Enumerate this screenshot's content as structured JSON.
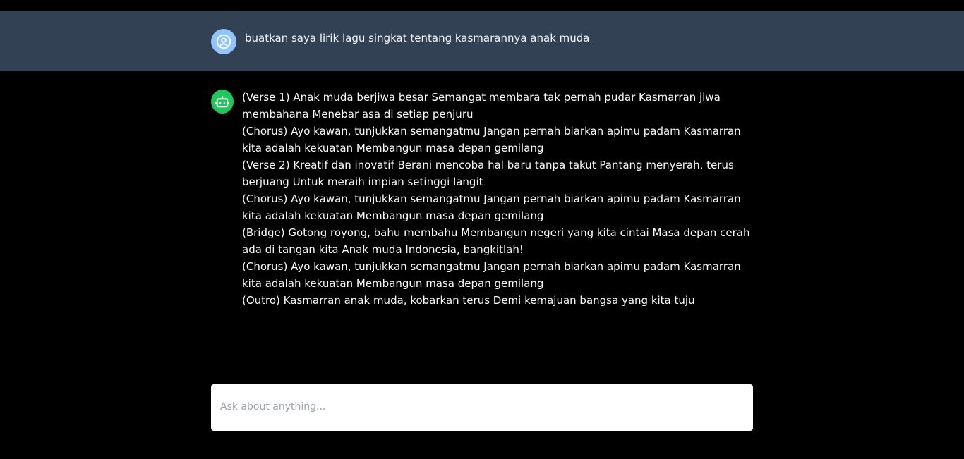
{
  "user_message": {
    "avatar_icon": "user-circle-icon",
    "text": "buatkan saya lirik lagu singkat tentang kasmarannya anak muda"
  },
  "assistant_message": {
    "avatar_icon": "robot-icon",
    "lines": [
      "(Verse 1) Anak muda berjiwa besar Semangat membara tak pernah pudar Kasmarran jiwa membahana Menebar asa di setiap penjuru",
      "(Chorus) Ayo kawan, tunjukkan semangatmu Jangan pernah biarkan apimu padam Kasmarran kita adalah kekuatan Membangun masa depan gemilang",
      "(Verse 2) Kreatif dan inovatif Berani mencoba hal baru tanpa takut Pantang menyerah, terus berjuang Untuk meraih impian setinggi langit",
      "(Chorus) Ayo kawan, tunjukkan semangatmu Jangan pernah biarkan apimu padam Kasmarran kita adalah kekuatan Membangun masa depan gemilang",
      "(Bridge) Gotong royong, bahu membahu Membangun negeri yang kita cintai Masa depan cerah ada di tangan kita Anak muda Indonesia, bangkitlah!",
      "(Chorus) Ayo kawan, tunjukkan semangatmu Jangan pernah biarkan apimu padam Kasmarran kita adalah kekuatan Membangun masa depan gemilang",
      "(Outro) Kasmarran anak muda, kobarkan terus Demi kemajuan bangsa yang kita tuju"
    ]
  },
  "composer": {
    "placeholder": "Ask about anything...",
    "value": ""
  },
  "colors": {
    "background": "#000000",
    "user_row": "#334155",
    "user_avatar": "#93c5fd",
    "bot_avatar": "#22c55e"
  }
}
